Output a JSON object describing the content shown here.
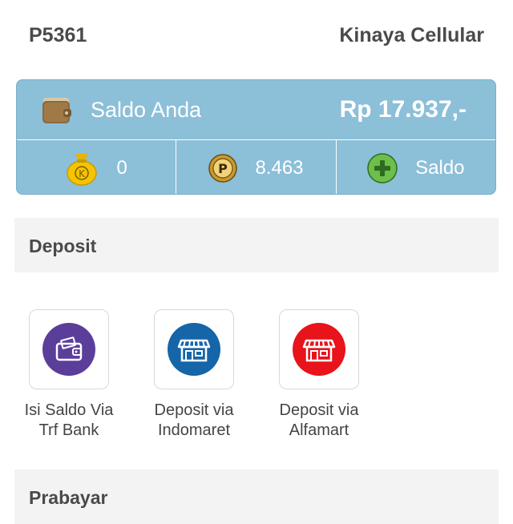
{
  "header": {
    "id": "P5361",
    "store": "Kinaya Cellular"
  },
  "balance": {
    "label": "Saldo Anda",
    "amount": "Rp 17.937,-",
    "stats": [
      {
        "icon": "money-bag-k-icon",
        "value": "0"
      },
      {
        "icon": "coin-p-icon",
        "value": "8.463"
      },
      {
        "icon": "plus-circle-icon",
        "value": "Saldo"
      }
    ]
  },
  "sections": {
    "deposit": "Deposit",
    "prabayar": "Prabayar"
  },
  "deposit_items": [
    {
      "line1": "Isi Saldo Via",
      "line2": "Trf Bank",
      "icon": "wallet-card-icon",
      "color": "#5b3e9a"
    },
    {
      "line1": "Deposit via",
      "line2": "Indomaret",
      "icon": "store-icon",
      "color": "#1565a8"
    },
    {
      "line1": "Deposit via",
      "line2": "Alfamart",
      "icon": "store-icon",
      "color": "#e8131b"
    }
  ],
  "colors": {
    "card": "#8cbfd8",
    "accent_green": "#6cbf4a"
  }
}
